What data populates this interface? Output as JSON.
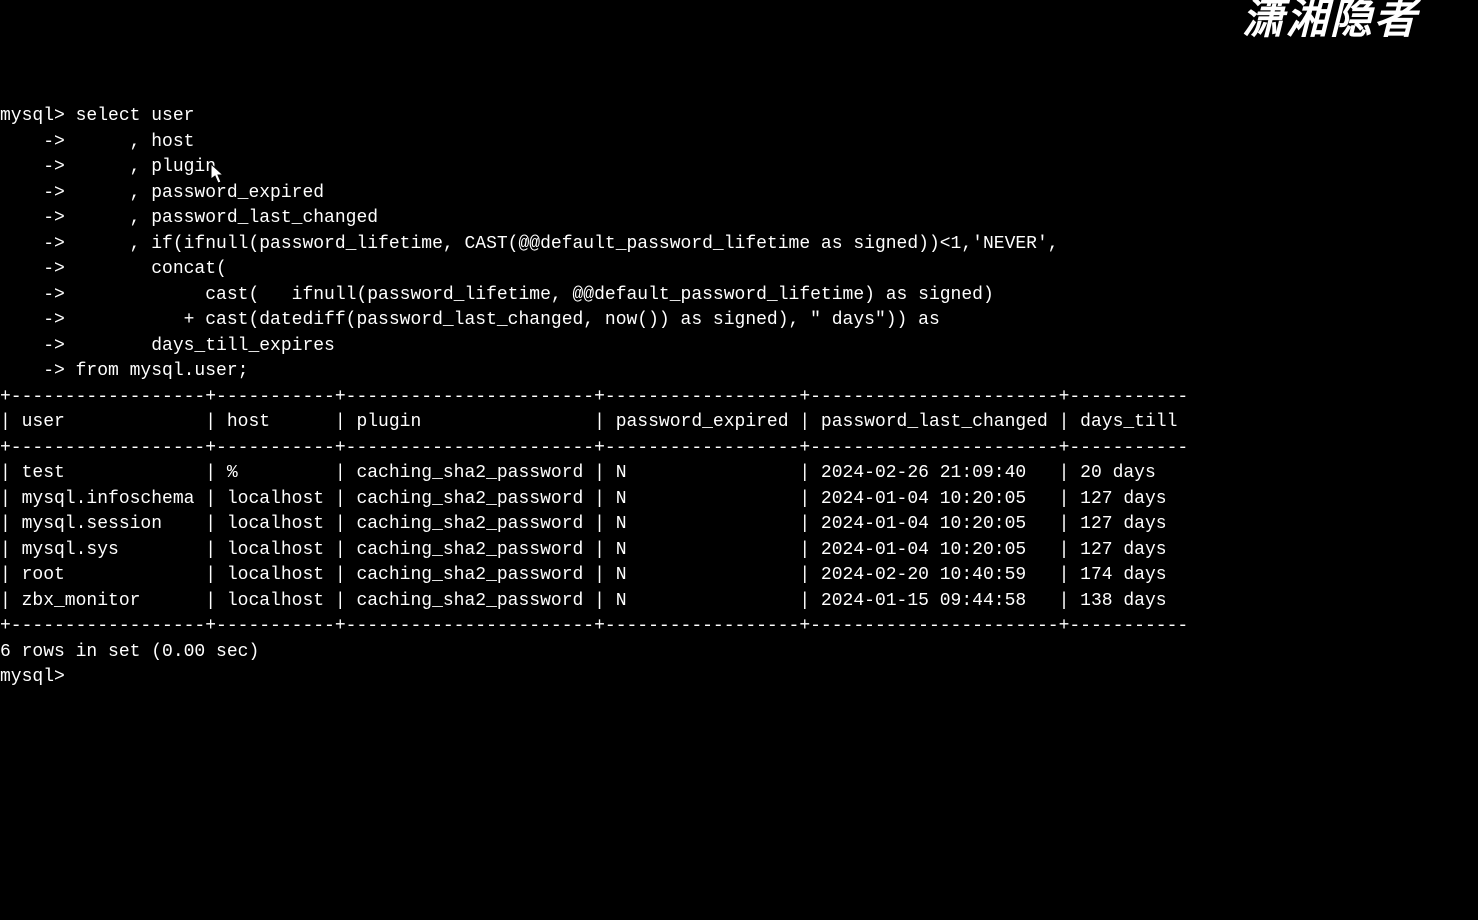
{
  "watermark": "潇湘隐者",
  "query_lines": [
    "mysql> select user",
    "    ->      , host",
    "    ->      , plugin",
    "    ->      , password_expired",
    "    ->      , password_last_changed",
    "    ->      , if(ifnull(password_lifetime, CAST(@@default_password_lifetime as signed))<1,'NEVER',",
    "    ->        concat(",
    "    ->             cast(   ifnull(password_lifetime, @@default_password_lifetime) as signed)",
    "    ->           + cast(datediff(password_last_changed, now()) as signed), \" days\")) as",
    "    ->        days_till_expires",
    "    -> from mysql.user;"
  ],
  "sep": "+------------------+-----------+-----------------------+------------------+-----------------------+-----------",
  "header": "| user             | host      | plugin                | password_expired | password_last_changed | days_till",
  "columns": [
    "user",
    "host",
    "plugin",
    "password_expired",
    "password_last_changed",
    "days_till"
  ],
  "rows": [
    {
      "user": "test",
      "host": "%",
      "plugin": "caching_sha2_password",
      "password_expired": "N",
      "password_last_changed": "2024-02-26 21:09:40",
      "days_till": "20 days"
    },
    {
      "user": "mysql.infoschema",
      "host": "localhost",
      "plugin": "caching_sha2_password",
      "password_expired": "N",
      "password_last_changed": "2024-01-04 10:20:05",
      "days_till": "127 days"
    },
    {
      "user": "mysql.session",
      "host": "localhost",
      "plugin": "caching_sha2_password",
      "password_expired": "N",
      "password_last_changed": "2024-01-04 10:20:05",
      "days_till": "127 days"
    },
    {
      "user": "mysql.sys",
      "host": "localhost",
      "plugin": "caching_sha2_password",
      "password_expired": "N",
      "password_last_changed": "2024-01-04 10:20:05",
      "days_till": "127 days"
    },
    {
      "user": "root",
      "host": "localhost",
      "plugin": "caching_sha2_password",
      "password_expired": "N",
      "password_last_changed": "2024-02-20 10:40:59",
      "days_till": "174 days"
    },
    {
      "user": "zbx_monitor",
      "host": "localhost",
      "plugin": "caching_sha2_password",
      "password_expired": "N",
      "password_last_changed": "2024-01-15 09:44:58",
      "days_till": "138 days"
    }
  ],
  "footer": "6 rows in set (0.00 sec)",
  "prompt": "mysql> ",
  "widths": {
    "user": 16,
    "host": 9,
    "plugin": 21,
    "password_expired": 16,
    "password_last_changed": 21,
    "days_till": 8
  }
}
